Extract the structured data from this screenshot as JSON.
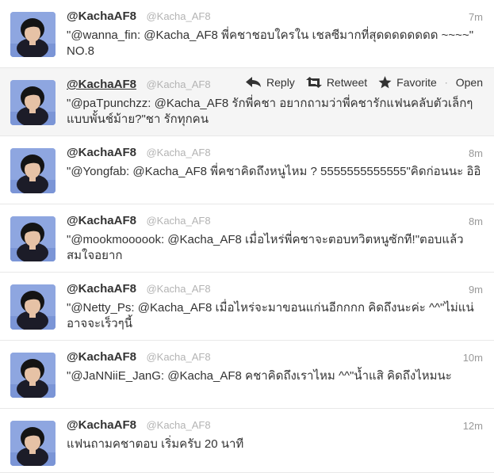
{
  "tweets": [
    {
      "fullname": "@KachaAF8",
      "username": "@Kacha_AF8",
      "time": "7m",
      "text": "\"@wanna_fin: @Kacha_AF8 พี่คชาชอบใครใน เชลซีมากที่สุดดดดดดดด ~~~~\" NO.8"
    },
    {
      "fullname": "@KachaAF8",
      "username": "@Kacha_AF8",
      "time": "",
      "text": "\"@paTpunchzz: @Kacha_AF8 รักพี่คชา อยากถามว่าพี่คชารักแฟนคลับตัวเล็กๆแบบพั้นช์ม้าย?\"ชา รักทุกคน",
      "actions": {
        "reply": "Reply",
        "retweet": "Retweet",
        "favorite": "Favorite",
        "open": "Open"
      }
    },
    {
      "fullname": "@KachaAF8",
      "username": "@Kacha_AF8",
      "time": "8m",
      "text": "\"@Yongfab: @Kacha_AF8 พี่คชาคิดถึงหนูไหม ? 5555555555555\"คิดก่อนนะ อิอิ"
    },
    {
      "fullname": "@KachaAF8",
      "username": "@Kacha_AF8",
      "time": "8m",
      "text": "\"@mookmoooook: @Kacha_AF8 เมื่อไหร่พี่คชาจะตอบทวิตหนูซักที!\"ตอบแล้วสมใจอยาก"
    },
    {
      "fullname": "@KachaAF8",
      "username": "@Kacha_AF8",
      "time": "9m",
      "text": "\"@Netty_Ps: @Kacha_AF8 เมื่อไหร่จะมาขอนแก่นอีกกกก คิดถึงนะค่ะ ^^\"ไม่แน่อาจจะเร็วๆนี้"
    },
    {
      "fullname": "@KachaAF8",
      "username": "@Kacha_AF8",
      "time": "10m",
      "text": "\"@JaNNiiE_JanG: @Kacha_AF8 คชาคิดถึงเราไหม ^^\"น้ำแสิ คิดถึงไหมนะ"
    },
    {
      "fullname": "@KachaAF8",
      "username": "@Kacha_AF8",
      "time": "12m",
      "text": "แฟนถามคชาตอบ เริ่มครับ 20 นาที"
    }
  ],
  "colors": {
    "avatar_bg": "#8ea6e0",
    "hover_bg": "#f5f5f5",
    "username": "#b3b3b3"
  },
  "icons": {
    "avatar": "avatar",
    "reply": "reply-icon",
    "retweet": "retweet-icon",
    "favorite": "star-icon"
  }
}
